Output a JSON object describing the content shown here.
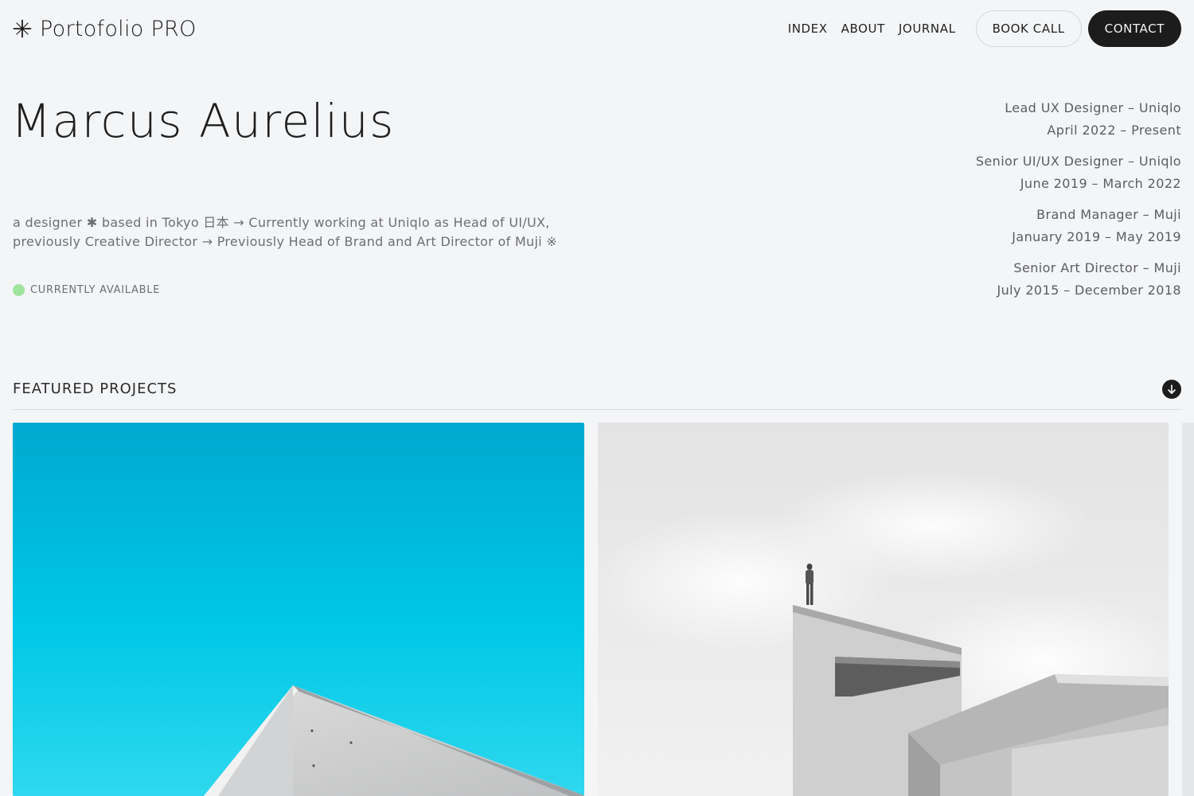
{
  "header": {
    "logo_icon": "asterisk-star-icon",
    "brand": "Portofolio PRO",
    "nav": [
      "INDEX",
      "ABOUT",
      "JOURNAL"
    ],
    "book_call": "BOOK CALL",
    "contact": "CONTACT"
  },
  "hero": {
    "name": "Marcus Aurelius",
    "bio": "a designer ✱ based in Tokyo 日本 → Currently working at Uniqlo as Head of UI/UX, previously Creative Director → Previously Head of Brand and Art Director of Muji ※",
    "status": "CURRENTLY AVAILABLE",
    "status_color": "#9ee39e"
  },
  "experience": [
    {
      "role": "Lead UX Designer – Uniqlo",
      "dates": "April 2022 – Present"
    },
    {
      "role": "Senior UI/UX Designer – Uniqlo",
      "dates": "June 2019 – March 2022"
    },
    {
      "role": "Brand Manager – Muji",
      "dates": "January 2019 – May 2019"
    },
    {
      "role": "Senior Art Director – Muji",
      "dates": "July 2015 – December 2018"
    }
  ],
  "featured": {
    "title": "FEATURED PROJECTS",
    "scroll_icon": "arrow-down-icon"
  },
  "colors": {
    "background": "#f4f5f7",
    "dark": "#1c1c1c",
    "sky": "#00b5d6"
  }
}
